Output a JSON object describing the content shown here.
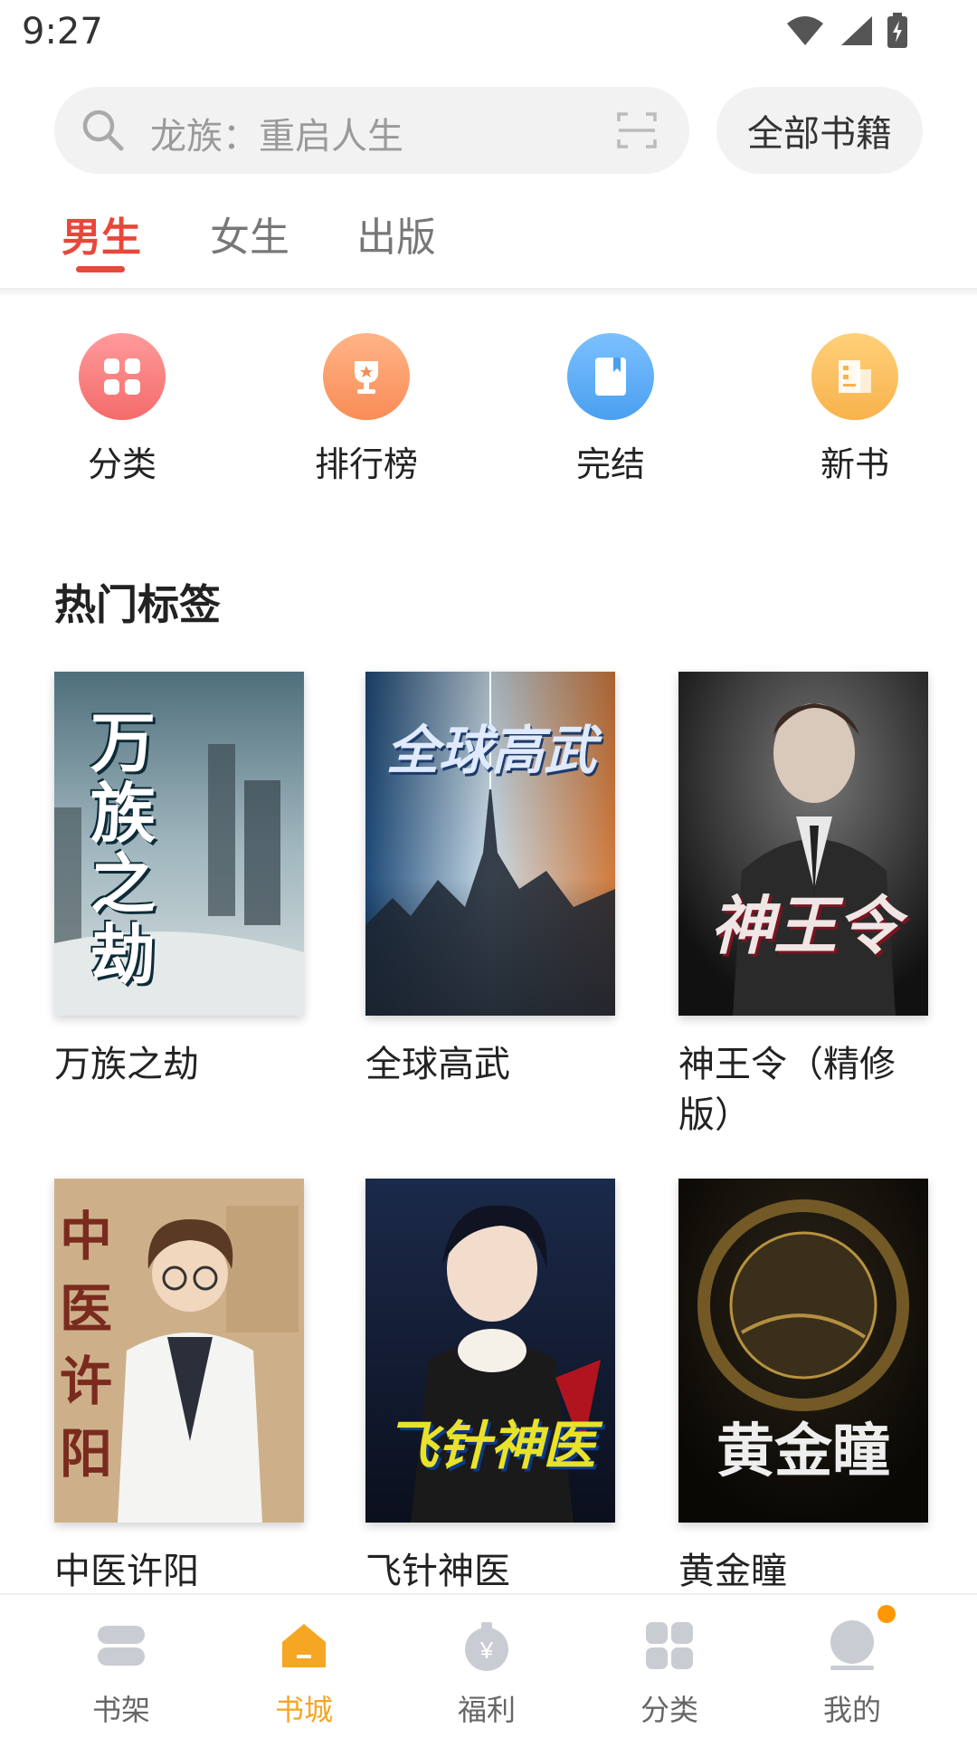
{
  "status_bar": {
    "time": "9:27"
  },
  "search": {
    "placeholder": "龙族：重启人生",
    "all_books_label": "全部书籍"
  },
  "tabs": [
    {
      "label": "男生",
      "active": true
    },
    {
      "label": "女生",
      "active": false
    },
    {
      "label": "出版",
      "active": false
    }
  ],
  "quick_links": [
    {
      "label": "分类",
      "icon": "category-grid-icon",
      "color": "#f46b6b"
    },
    {
      "label": "排行榜",
      "icon": "trophy-icon",
      "color": "#f98c57"
    },
    {
      "label": "完结",
      "icon": "book-icon",
      "color": "#4a9ff0"
    },
    {
      "label": "新书",
      "icon": "new-book-icon",
      "color": "#f7b24b"
    }
  ],
  "hot_tags": {
    "title": "热门标签",
    "books": [
      {
        "title": "万族之劫",
        "cover_text": "万族之劫"
      },
      {
        "title": "全球高武",
        "cover_text": "全球高武"
      },
      {
        "title": "神王令（精修版）",
        "cover_text": "神王令"
      },
      {
        "title": "中医许阳",
        "cover_text": "中医许阳"
      },
      {
        "title": "飞针神医",
        "cover_text": "飞针神医"
      },
      {
        "title": "黄金瞳",
        "cover_text": "黄金瞳"
      }
    ]
  },
  "bottom_nav": [
    {
      "label": "书架",
      "icon": "bookshelf-icon",
      "active": false
    },
    {
      "label": "书城",
      "icon": "bookstore-icon",
      "active": true
    },
    {
      "label": "福利",
      "icon": "money-bag-icon",
      "active": false
    },
    {
      "label": "分类",
      "icon": "category-icon",
      "active": false
    },
    {
      "label": "我的",
      "icon": "profile-icon",
      "active": false
    }
  ],
  "colors": {
    "accent": "#e8473a",
    "nav_active": "#f5a623",
    "badge": "#ff9800"
  }
}
